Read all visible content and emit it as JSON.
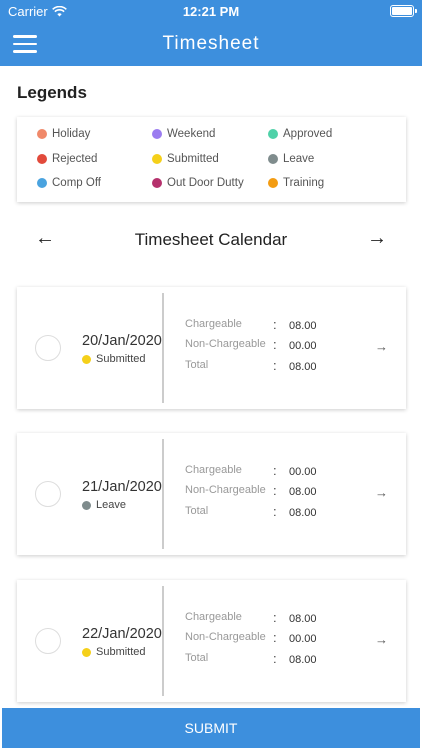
{
  "status_bar": {
    "carrier": "Carrier",
    "time": "12:21 PM"
  },
  "header": {
    "title": "Timesheet"
  },
  "legends": {
    "title": "Legends",
    "items": [
      {
        "label": "Holiday",
        "color": "#f0896a"
      },
      {
        "label": "Weekend",
        "color": "#9b7cf0"
      },
      {
        "label": "Approved",
        "color": "#4fd1a8"
      },
      {
        "label": "Rejected",
        "color": "#e24a3b"
      },
      {
        "label": "Submitted",
        "color": "#f5d01a"
      },
      {
        "label": "Leave",
        "color": "#7f8c8d"
      },
      {
        "label": "Comp Off",
        "color": "#4aa3df"
      },
      {
        "label": "Out Door Dutty",
        "color": "#b5316c"
      },
      {
        "label": "Training",
        "color": "#f39c12"
      }
    ]
  },
  "calendar": {
    "title": "Timesheet Calendar",
    "prev_icon": "arrow-left-icon",
    "next_icon": "arrow-right-icon"
  },
  "days": [
    {
      "date": "20/Jan/2020",
      "status": "Submitted",
      "status_color": "#f5d01a",
      "rows": [
        {
          "label": "Chargeable",
          "value": "08.00"
        },
        {
          "label": "Non-Chargeable",
          "value": "00.00"
        },
        {
          "label": "Total",
          "value": "08.00"
        }
      ]
    },
    {
      "date": "21/Jan/2020",
      "status": "Leave",
      "status_color": "#7f8c8d",
      "rows": [
        {
          "label": "Chargeable",
          "value": "00.00"
        },
        {
          "label": "Non-Chargeable",
          "value": "08.00"
        },
        {
          "label": "Total",
          "value": "08.00"
        }
      ]
    },
    {
      "date": "22/Jan/2020",
      "status": "Submitted",
      "status_color": "#f5d01a",
      "rows": [
        {
          "label": "Chargeable",
          "value": "08.00"
        },
        {
          "label": "Non-Chargeable",
          "value": "00.00"
        },
        {
          "label": "Total",
          "value": "08.00"
        }
      ]
    }
  ],
  "submit_label": "SUBMIT"
}
